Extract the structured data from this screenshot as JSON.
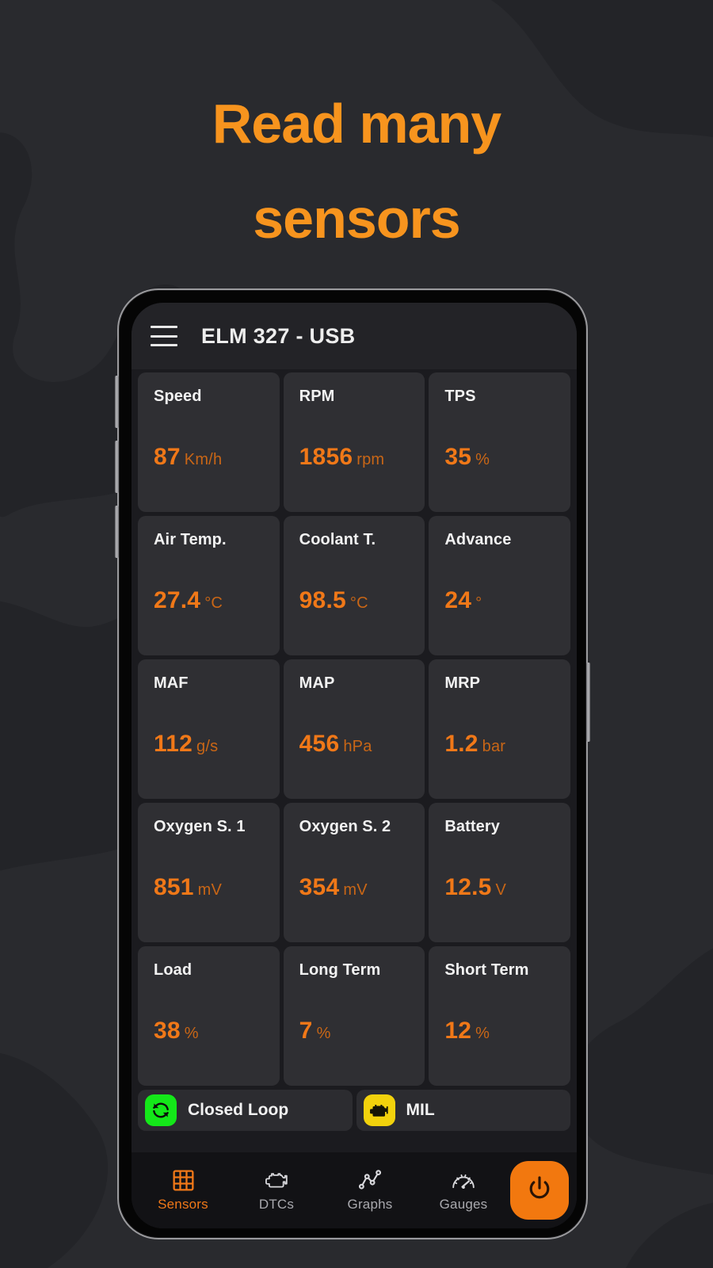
{
  "promo": {
    "headline_line1": "Read many",
    "headline_line2": "sensors",
    "accent_color": "#F7941E",
    "background_color": "#292A2E"
  },
  "app": {
    "header": {
      "menu_icon": "hamburger-menu-icon",
      "title": "ELM 327 - USB"
    },
    "sensors": [
      [
        {
          "name": "Speed",
          "value": "87",
          "unit": "Km/h"
        },
        {
          "name": "RPM",
          "value": "1856",
          "unit": "rpm"
        },
        {
          "name": "TPS",
          "value": "35",
          "unit": "%"
        }
      ],
      [
        {
          "name": "Air Temp.",
          "value": "27.4",
          "unit": "°C"
        },
        {
          "name": "Coolant T.",
          "value": "98.5",
          "unit": "°C"
        },
        {
          "name": "Advance",
          "value": "24",
          "unit": "°"
        }
      ],
      [
        {
          "name": "MAF",
          "value": "112",
          "unit": "g/s"
        },
        {
          "name": "MAP",
          "value": "456",
          "unit": "hPa"
        },
        {
          "name": "MRP",
          "value": "1.2",
          "unit": "bar"
        }
      ],
      [
        {
          "name": "Oxygen S. 1",
          "value": "851",
          "unit": "mV"
        },
        {
          "name": "Oxygen S. 2",
          "value": "354",
          "unit": "mV"
        },
        {
          "name": "Battery",
          "value": "12.5",
          "unit": "V"
        }
      ],
      [
        {
          "name": "Load",
          "value": "38",
          "unit": "%"
        },
        {
          "name": "Long Term",
          "value": "7",
          "unit": "%"
        },
        {
          "name": "Short Term",
          "value": "12",
          "unit": "%"
        }
      ]
    ],
    "status_chips": [
      {
        "label": "Closed Loop",
        "icon": "loop-refresh-icon",
        "badge_color": "#14E819"
      },
      {
        "label": "MIL",
        "icon": "check-engine-icon",
        "badge_color": "#F2D20C"
      }
    ],
    "bottom_nav": {
      "items": [
        {
          "label": "Sensors",
          "icon": "grid-icon",
          "active": true
        },
        {
          "label": "DTCs",
          "icon": "check-engine-icon",
          "active": false
        },
        {
          "label": "Graphs",
          "icon": "line-chart-icon",
          "active": false
        },
        {
          "label": "Gauges",
          "icon": "speedometer-icon",
          "active": false
        }
      ],
      "power_button": {
        "icon": "power-icon",
        "color": "#F2780F"
      }
    },
    "colors": {
      "value_orange": "#F07818",
      "unit_orange": "#C96616",
      "card_bg": "#2F2F33",
      "screen_bg": "#1B1B1F",
      "nav_bg": "#121215"
    }
  }
}
